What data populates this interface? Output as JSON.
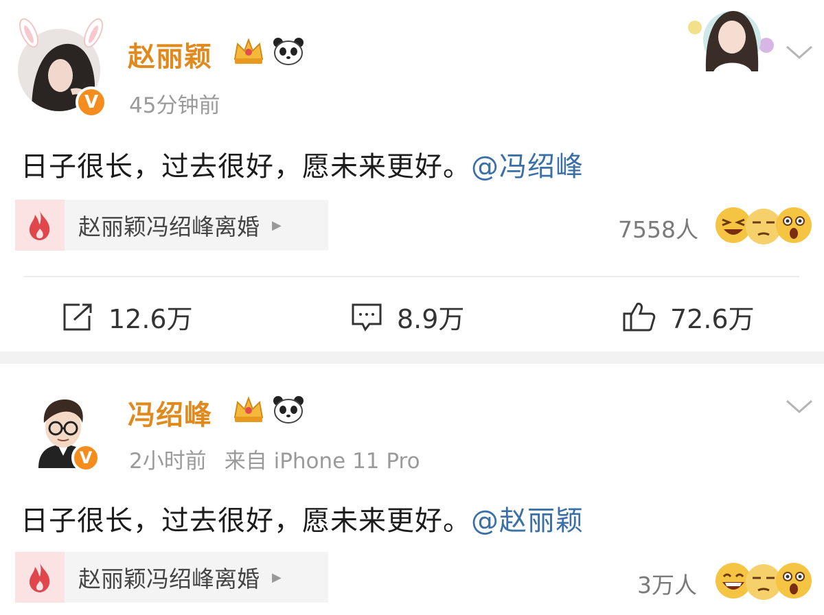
{
  "posts": [
    {
      "author": "赵丽颖",
      "time": "45分钟前",
      "source": "",
      "text": "日子很长，过去很好，愿未来更好。",
      "mention": "@冯绍峰",
      "topic": "赵丽颖冯绍峰离婚",
      "people_count": "7558人",
      "stats": {
        "share": "12.6万",
        "comment": "8.9万",
        "like": "72.6万"
      }
    },
    {
      "author": "冯绍峰",
      "time": "2小时前",
      "source": "来自 iPhone 11 Pro",
      "text": "日子很长，过去很好，愿未来更好。",
      "mention": "@赵丽颖",
      "topic": "赵丽颖冯绍峰离婚",
      "people_count": "3万人"
    }
  ],
  "badge_letter": "V",
  "topic_arrow": "▶",
  "colors": {
    "username": "#e08a1e",
    "mention": "#3a6fa8",
    "verified": "#f58c1e",
    "fire": "#e0474c"
  }
}
